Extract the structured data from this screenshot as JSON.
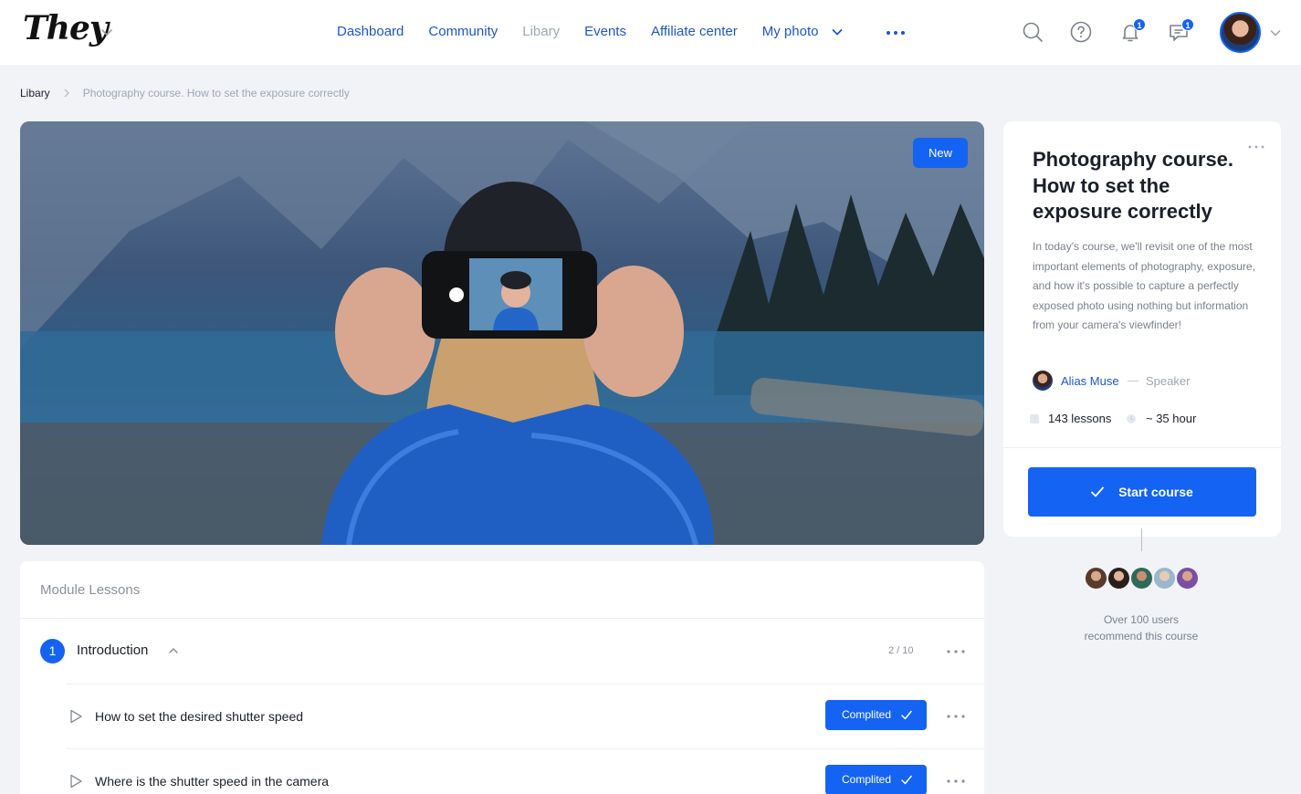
{
  "header": {
    "logo": "They",
    "nav": [
      {
        "label": "Dashboard",
        "muted": false
      },
      {
        "label": "Community",
        "muted": false
      },
      {
        "label": "Libary",
        "muted": true
      },
      {
        "label": "Events",
        "muted": false
      },
      {
        "label": "Affiliate center",
        "muted": false
      },
      {
        "label": "My photo",
        "muted": false
      }
    ],
    "notifications_count": "1",
    "messages_count": "1",
    "icons": [
      "search-icon",
      "help-icon",
      "bell-icon",
      "chat-icon",
      "more-icon",
      "chevron-down-icon"
    ]
  },
  "breadcrumb": {
    "root": "Libary",
    "current": "Photography course. How to set the exposure correctly"
  },
  "hero": {
    "badge": "New"
  },
  "lessons": {
    "title": "Module Lessons",
    "module": {
      "number": "1",
      "title": "Introduction",
      "progress": "2 / 10"
    },
    "items": [
      {
        "label": "How to set the desired shutter speed",
        "status": "Complited"
      },
      {
        "label": "Where is the shutter speed in the camera",
        "status": "Complited"
      }
    ]
  },
  "course": {
    "title": "Photography course. How to set the exposure correctly",
    "description": "In today's course, we'll revisit one of the most important elements of photography, exposure, and how it's possible to capture a perfectly exposed photo using nothing but information from your camera's viewfinder!",
    "speaker_name": "Alias Muse",
    "speaker_role": "Speaker",
    "lessons_count": "143 lessons",
    "duration": "~ 35 hour",
    "start_label": "Start course"
  },
  "recommend": {
    "line1": "Over 100 users",
    "line2": "recommend this course"
  },
  "colors": {
    "accent": "#1463f3",
    "link": "#1d56c9",
    "background": "#f1f3f6"
  }
}
